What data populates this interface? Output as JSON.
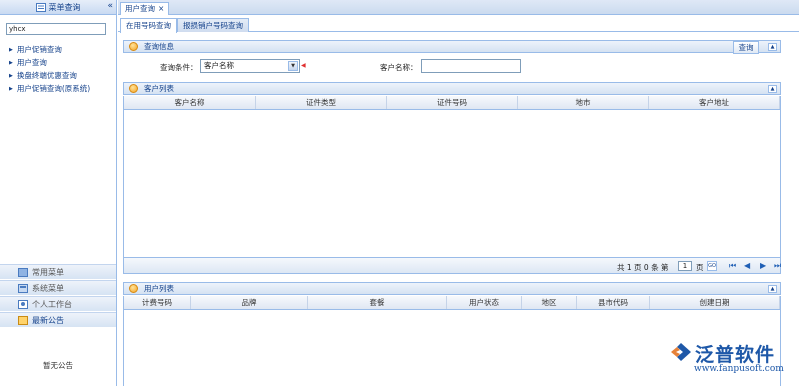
{
  "sidebar": {
    "title": "菜单查询",
    "collapse_icon": "«",
    "search_value": "yhcx",
    "items": [
      {
        "label": "用户促销查询"
      },
      {
        "label": "用户查询"
      },
      {
        "label": "换盘终端优惠查询"
      },
      {
        "label": "用户促销查询(原系统)"
      }
    ],
    "accordion": [
      {
        "label": "常用菜单",
        "icon": "menu-icon"
      },
      {
        "label": "系统菜单",
        "icon": "system-icon"
      },
      {
        "label": "个人工作台",
        "icon": "desk-icon"
      },
      {
        "label": "最新公告",
        "icon": "notice-icon"
      }
    ],
    "notice_empty": "暂无公告"
  },
  "top_tab": {
    "label": "用户查询",
    "close": "×"
  },
  "sub_tabs": [
    {
      "label": "在用号码查询",
      "active": true
    },
    {
      "label": "报损销户号码查询",
      "active": false
    }
  ],
  "query_panel": {
    "title": "查询信息",
    "query_button": "查询",
    "condition_label": "查询条件：",
    "condition_value": "客户名称",
    "name_label": "客户名称："
  },
  "customer_panel": {
    "title": "客户列表",
    "columns": [
      "客户名称",
      "证件类型",
      "证件号码",
      "地市",
      "客户地址"
    ]
  },
  "pager": {
    "prefix": "共 1 页 0 条 第",
    "page": "1",
    "suffix": "页",
    "go": "GO"
  },
  "user_panel": {
    "title": "用户列表",
    "columns": [
      "计费号码",
      "品牌",
      "套餐",
      "用户状态",
      "地区",
      "县市代码",
      "创建日期"
    ]
  },
  "watermark": {
    "brand": "泛普软件",
    "url": "www.fanpusoft.com"
  },
  "colors": {
    "accent": "#15428b",
    "border": "#99bbe8",
    "brand": "#1e58a8"
  }
}
